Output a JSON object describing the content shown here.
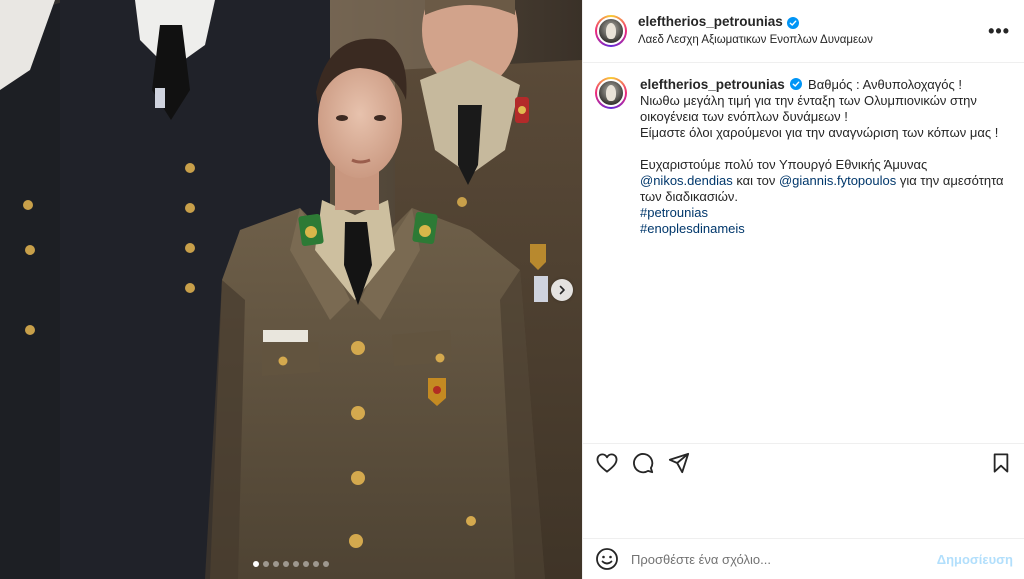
{
  "post": {
    "username": "eleftherios_petrounias",
    "location": "Λαεδ Λεσχη Αξιωματικων Ενοπλων Δυναμεων",
    "more_icon": "more-horizontal-icon",
    "caption": {
      "line1": "Βαθμός : Ανθυπολοχαγός !",
      "line2": "Νιωθω μεγάλη τιμή για την ένταξη των Ολυμπιονικών στην",
      "line3": "οικογένεια των ενόπλων δυνάμεων !",
      "line4": "Είμαστε όλοι χαρούμενοι για την αναγνώριση των κόπων μας !",
      "line5": "Ευχαριστούμε πολύ τον Υπουργό Εθνικής Άμυνας",
      "mention1": "@nikos.dendias",
      "mid_text": " και τον ",
      "mention2": "@giannis.fytopoulos",
      "line6_tail": " για την αμεσότητα",
      "line7": "των διαδικασιών.",
      "hashtag1": "#petrounias",
      "hashtag2": "#enoplesdinameis"
    }
  },
  "carousel": {
    "dot_count": 8,
    "active_index": 0,
    "next_icon": "chevron-right-icon"
  },
  "actions": {
    "like_icon": "heart-icon",
    "comment_icon": "comment-icon",
    "share_icon": "send-icon",
    "save_icon": "bookmark-icon"
  },
  "comment_bar": {
    "emoji_icon": "emoji-icon",
    "placeholder": "Προσθέστε ένα σχόλιο...",
    "post_label": "Δημοσίευση"
  },
  "colors": {
    "verified_blue": "#0095f6",
    "link_blue": "#00376b",
    "post_button_disabled": "#b2dffc"
  }
}
